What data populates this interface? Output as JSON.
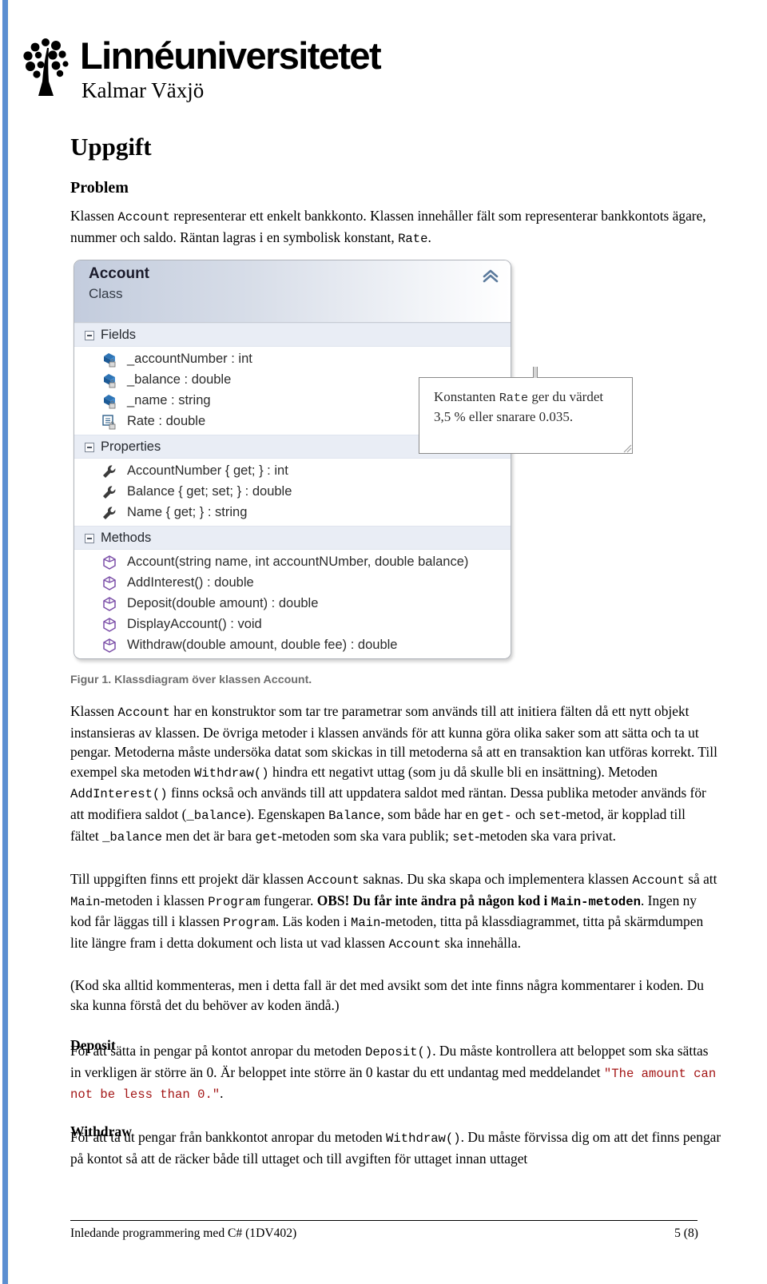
{
  "page": {
    "accent_color": "#5b8fd0"
  },
  "logo": {
    "wordmark": "Linnéuniversitetet",
    "subtitle": "Kalmar Växjö",
    "icon": "tree-icon"
  },
  "headings": {
    "title": "Uppgift",
    "problem": "Problem",
    "deposit": "Deposit",
    "withdraw": "Withdraw"
  },
  "intro": {
    "part1": "Klassen ",
    "code1": "Account",
    "part2": " representerar ett enkelt bankkonto. Klassen innehåller fält som representerar bankkontots ägare, nummer och saldo. Räntan lagras i en symbolisk konstant, ",
    "code2": "Rate",
    "part3": "."
  },
  "class_diagram": {
    "title": "Account",
    "kind": "Class",
    "collapse_icon": "chevron-up-double-icon",
    "groups": [
      {
        "name": "Fields",
        "expander_icon": "minus-square-icon",
        "members": [
          {
            "label": "_accountNumber : int",
            "icon": "field-private-icon"
          },
          {
            "label": "_balance : double",
            "icon": "field-private-icon"
          },
          {
            "label": "_name : string",
            "icon": "field-private-icon"
          },
          {
            "label": "Rate : double",
            "icon": "constant-private-icon"
          }
        ]
      },
      {
        "name": "Properties",
        "expander_icon": "minus-square-icon",
        "members": [
          {
            "label": "AccountNumber { get; } : int",
            "icon": "property-wrench-icon"
          },
          {
            "label": "Balance { get; set; } : double",
            "icon": "property-wrench-icon"
          },
          {
            "label": "Name { get; } : string",
            "icon": "property-wrench-icon"
          }
        ]
      },
      {
        "name": "Methods",
        "expander_icon": "minus-square-icon",
        "members": [
          {
            "label": "Account(string name, int accountNUmber, double balance)",
            "icon": "method-cube-icon"
          },
          {
            "label": "AddInterest() : double",
            "icon": "method-cube-icon"
          },
          {
            "label": "Deposit(double amount) : double",
            "icon": "method-cube-icon"
          },
          {
            "label": "DisplayAccount() : void",
            "icon": "method-cube-icon"
          },
          {
            "label": "Withdraw(double amount, double fee) : double",
            "icon": "method-cube-icon"
          }
        ]
      }
    ]
  },
  "callout": {
    "part1": "Konstanten ",
    "code1": "Rate",
    "part2": " ger du värdet 3,5 % eller snarare 0.035.",
    "resize_handle_icon": "resize-handle-icon"
  },
  "figure_caption": "Figur 1. Klassdiagram över klassen Account.",
  "para_a": {
    "s1": "Klassen ",
    "c1": "Account",
    "s2": " har en konstruktor som tar tre parametrar som används till att initiera fälten då ett nytt objekt instansieras av klassen. De övriga metoder i klassen används för att kunna göra olika saker som att sätta och ta ut pengar. Metoderna måste undersöka datat som skickas in till metoderna så att en transaktion kan utföras korrekt. Till exempel ska metoden ",
    "c2": "Withdraw()",
    "s3": " hindra ett negativt uttag (som ju då skulle bli en insättning). Metoden ",
    "c3": "AddInterest()",
    "s4": " finns också och används till att uppdatera saldot med räntan. Dessa publika metoder används för att modifiera saldot (",
    "c4": "_balance",
    "s5": "). Egenskapen ",
    "c5": "Balance",
    "s6": ", som både har en ",
    "c6": "get-",
    "s7": " och ",
    "c7": "set",
    "s8": "-metod, är kopplad till fältet ",
    "c8": "_balance",
    "s9": " men det är bara ",
    "c9": "get",
    "s10": "-metoden som ska vara publik; ",
    "c10": "set",
    "s11": "-metoden ska vara privat."
  },
  "para_b": {
    "s1": "Till uppgiften finns ett projekt där klassen ",
    "c1": "Account",
    "s2": " saknas. Du ska skapa och implementera klassen ",
    "c2": "Account",
    "s3": " så att ",
    "c3": "Main",
    "s4": "-metoden i klassen ",
    "c4": "Program",
    "s5": " fungerar. ",
    "b1": "OBS! Du får inte ändra på någon kod i ",
    "b2": "Main-metoden",
    "s6": ". Ingen ny kod får läggas till i klassen ",
    "c5": "Program",
    "s7": ". Läs koden i ",
    "c6": "Main",
    "s8": "-metoden, titta på klassdiagrammet, titta på skärmdumpen lite längre fram i detta dokument och lista ut vad klassen ",
    "c7": "Account",
    "s9": " ska innehålla."
  },
  "para_c": "(Kod ska alltid kommenteras, men i detta fall är det med avsikt som det inte finns några kommentarer i koden. Du ska kunna förstå det du behöver av koden ändå.)",
  "para_deposit": {
    "s1": "För att sätta in pengar på kontot anropar du metoden ",
    "c1": "Deposit()",
    "s2": ". Du måste kontrollera att beloppet som ska sättas in verkligen är större än 0. Är beloppet inte större än 0 kastar du ett undantag med meddelandet ",
    "str1": "\"The amount can not be less than 0.\"",
    "s3": "."
  },
  "para_withdraw": {
    "s1": "För att ta ut pengar från bankkontot anropar du metoden ",
    "c1": "Withdraw()",
    "s2": ". Du måste förvissa dig om att det finns pengar på kontot så att de räcker både till uttaget och till avgiften för uttaget innan uttaget"
  },
  "footer": {
    "left": "Inledande programmering med C# (1DV402)",
    "right": "5 (8)"
  }
}
